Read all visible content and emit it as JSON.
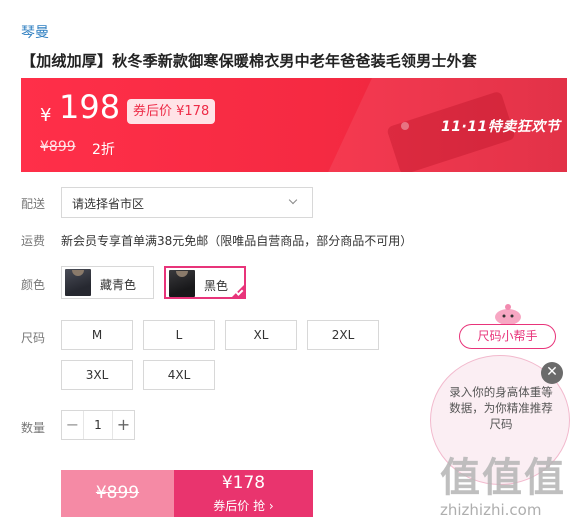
{
  "brand": "琴曼",
  "product_title": "【加绒加厚】秋冬季新款御寒保暖棉衣男中老年爸爸装毛领男士外套",
  "price": {
    "currency": "¥",
    "current": "198",
    "coupon_price_label": "券后价 ¥178",
    "original": "¥899",
    "discount": "2折",
    "promo": "11·11特卖狂欢节"
  },
  "delivery": {
    "label": "配送",
    "placeholder": "请选择省市区"
  },
  "shipping": {
    "label": "运费",
    "text": "新会员专享首单满38元免邮（限唯品自营商品，部分商品不可用）"
  },
  "color": {
    "label": "颜色",
    "options": [
      {
        "name": "藏青色",
        "selected": false
      },
      {
        "name": "黑色",
        "selected": true
      }
    ]
  },
  "size": {
    "label": "尺码",
    "options": [
      "M",
      "L",
      "XL",
      "2XL",
      "3XL",
      "4XL"
    ]
  },
  "quantity": {
    "label": "数量",
    "value": "1",
    "minus": "−",
    "plus": "+"
  },
  "buy": {
    "original": "¥899",
    "coupon_price": "¥178",
    "coupon_action": "券后价 抢 ›"
  },
  "size_helper": {
    "pill_label": "尺码小帮手",
    "bubble_text": "录入你的身高体重等数据，为你精准推荐尺码",
    "close": "✕"
  },
  "watermark": {
    "big": "值值值",
    "small": "zhizhizhi.com"
  },
  "colors": {
    "accent": "#e8347a",
    "banner_red": "#f52a42",
    "brand_blue": "#2f7fc1"
  }
}
